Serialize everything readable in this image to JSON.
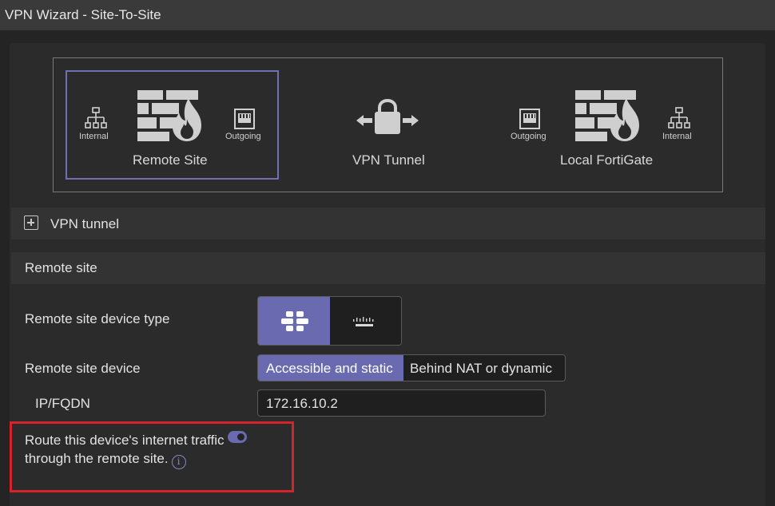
{
  "window": {
    "title": "VPN Wizard - Site-To-Site"
  },
  "diagram": {
    "remote_site": {
      "label": "Remote Site",
      "internal_label": "Internal",
      "outgoing_label": "Outgoing",
      "icons": [
        "network-icon",
        "firewall-icon",
        "port-icon"
      ]
    },
    "tunnel": {
      "label": "VPN Tunnel",
      "icon": "lock-icon"
    },
    "local": {
      "label": "Local FortiGate",
      "internal_label": "Internal",
      "outgoing_label": "Outgoing",
      "icons": [
        "port-icon",
        "firewall-icon",
        "network-icon"
      ]
    },
    "accent_color": "#6f6fb2"
  },
  "sections": {
    "vpn_tunnel": {
      "label": "VPN tunnel",
      "expand_icon": "plus-square-icon"
    },
    "remote_site": {
      "label": "Remote site"
    }
  },
  "form": {
    "device_type": {
      "label": "Remote site device type",
      "options": [
        "fortinet-logo-icon",
        "cisco-logo-icon"
      ],
      "selected": "fortinet-logo-icon"
    },
    "device": {
      "label": "Remote site device",
      "options": [
        "Accessible and static",
        "Behind NAT or dynamic"
      ],
      "selected": "Accessible and static"
    },
    "ip_fqdn": {
      "label": "IP/FQDN",
      "value": "172.16.10.2"
    },
    "route_internet": {
      "label": "Route this device's internet traffic through the remote site.",
      "enabled": true,
      "info_icon": "info-icon"
    }
  },
  "colors": {
    "selected": "#6a6ab0",
    "highlight_border": "#d4232a"
  }
}
